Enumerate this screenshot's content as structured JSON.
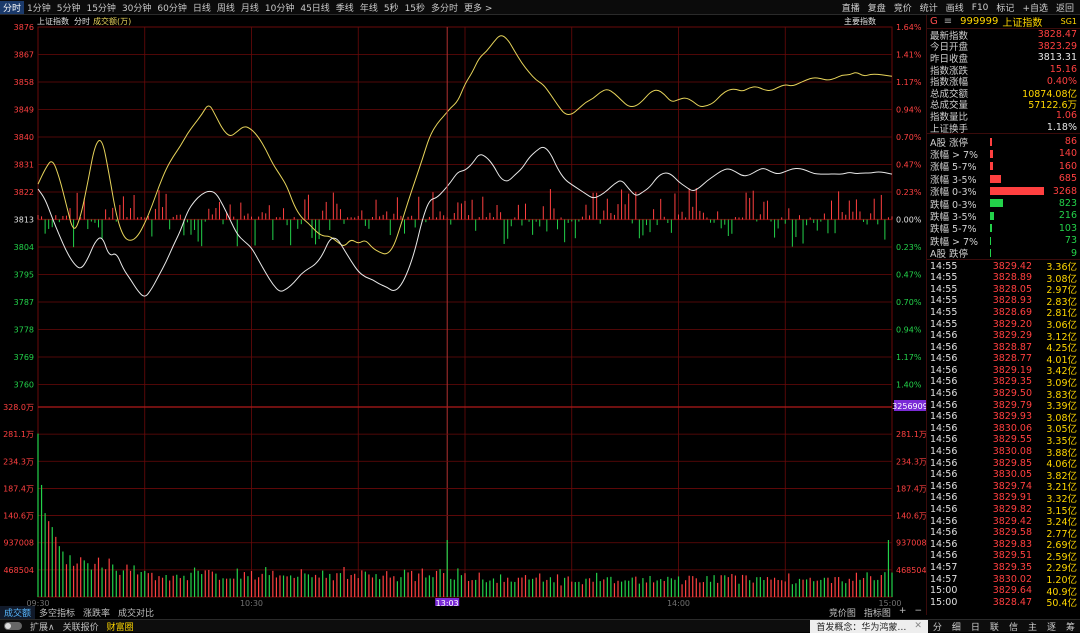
{
  "topbar": {
    "timeframes": [
      "分时",
      "1分钟",
      "5分钟",
      "15分钟",
      "30分钟",
      "60分钟",
      "日线",
      "周线",
      "月线",
      "10分钟",
      "45日线",
      "季线",
      "年线",
      "5秒",
      "15秒",
      "多分时",
      "更多 >"
    ],
    "right": [
      "直播",
      "复盘",
      "竞价",
      "统计",
      "画线",
      "F10",
      "标记",
      "+自选",
      "返回"
    ]
  },
  "chart_header": {
    "index_name": "上证指数",
    "period": "分时",
    "indicator": "成交额(万)",
    "right_label": "主要指数"
  },
  "price_axis": {
    "left": [
      "3876",
      "3867",
      "3858",
      "3849",
      "3840",
      "3831",
      "3822",
      "3813",
      "3804",
      "3795",
      "3787",
      "3778",
      "3769",
      "3760"
    ],
    "right": [
      "1.64%",
      "1.41%",
      "1.17%",
      "0.94%",
      "0.70%",
      "0.47%",
      "0.23%",
      "0.00%",
      "0.23%",
      "0.47%",
      "0.70%",
      "0.94%",
      "1.17%",
      "1.40%"
    ],
    "base_value": 3813.31
  },
  "volume_axis": {
    "left": [
      "328.0万",
      "281.1万",
      "234.3万",
      "187.4万",
      "140.6万",
      "937008",
      "468504"
    ],
    "right": [
      "281.1万",
      "234.3万",
      "187.4万",
      "140.6万",
      "937008",
      "468504"
    ],
    "highlight": "3256909"
  },
  "time_axis": {
    "labels": [
      "09:30",
      "10:30",
      "13:03",
      "14:00",
      "15:00"
    ],
    "cursor_label": "13:03"
  },
  "colors": {
    "up": "#ff4040",
    "down": "#23d24a",
    "price_line": "#e8e8e8",
    "avg_line": "#e6d35a",
    "grid": "#6a0a0a",
    "accent": "#ffd700",
    "cursor": "#7a2ad6"
  },
  "chart_data": {
    "type": "line",
    "price_series_keyframes": [
      [
        0,
        3823
      ],
      [
        4,
        3820
      ],
      [
        8,
        3814
      ],
      [
        12,
        3808
      ],
      [
        16,
        3803
      ],
      [
        20,
        3799
      ],
      [
        24,
        3797
      ],
      [
        28,
        3801
      ],
      [
        32,
        3806
      ],
      [
        36,
        3808
      ],
      [
        40,
        3801
      ],
      [
        44,
        3803
      ],
      [
        48,
        3797
      ],
      [
        52,
        3794
      ],
      [
        56,
        3790
      ],
      [
        60,
        3788
      ],
      [
        64,
        3791
      ],
      [
        68,
        3795
      ],
      [
        72,
        3800
      ],
      [
        76,
        3805
      ],
      [
        80,
        3810
      ],
      [
        84,
        3816
      ],
      [
        88,
        3820
      ],
      [
        92,
        3822
      ],
      [
        96,
        3823
      ],
      [
        100,
        3822
      ],
      [
        104,
        3818
      ],
      [
        108,
        3813
      ],
      [
        112,
        3809
      ],
      [
        116,
        3806
      ],
      [
        120,
        3804
      ],
      [
        124,
        3800
      ],
      [
        128,
        3796
      ],
      [
        132,
        3792
      ],
      [
        136,
        3790
      ],
      [
        140,
        3791
      ],
      [
        144,
        3793
      ],
      [
        148,
        3796
      ],
      [
        152,
        3798
      ],
      [
        156,
        3799
      ],
      [
        160,
        3802
      ],
      [
        164,
        3807
      ],
      [
        168,
        3808
      ],
      [
        172,
        3804
      ],
      [
        176,
        3800
      ],
      [
        180,
        3797
      ],
      [
        184,
        3795
      ],
      [
        188,
        3794
      ],
      [
        192,
        3793
      ],
      [
        196,
        3792
      ],
      [
        200,
        3790
      ],
      [
        204,
        3792
      ],
      [
        208,
        3797
      ],
      [
        212,
        3804
      ],
      [
        216,
        3814
      ],
      [
        220,
        3820
      ],
      [
        224,
        3821
      ],
      [
        228,
        3823
      ],
      [
        232,
        3826
      ],
      [
        236,
        3829
      ],
      [
        240,
        3829
      ],
      [
        244,
        3832
      ],
      [
        248,
        3835
      ],
      [
        252,
        3834
      ],
      [
        256,
        3831
      ],
      [
        260,
        3827
      ],
      [
        264,
        3826
      ],
      [
        268,
        3828
      ],
      [
        272,
        3830
      ],
      [
        276,
        3834
      ],
      [
        280,
        3836
      ],
      [
        284,
        3837
      ],
      [
        288,
        3835
      ],
      [
        292,
        3830
      ],
      [
        296,
        3827
      ],
      [
        300,
        3825
      ],
      [
        304,
        3823
      ],
      [
        308,
        3822
      ],
      [
        312,
        3820
      ],
      [
        316,
        3821
      ],
      [
        320,
        3823
      ],
      [
        324,
        3825
      ],
      [
        328,
        3826
      ],
      [
        332,
        3824
      ],
      [
        336,
        3821
      ],
      [
        340,
        3822
      ],
      [
        344,
        3824
      ],
      [
        348,
        3827
      ],
      [
        352,
        3829
      ],
      [
        356,
        3828
      ],
      [
        360,
        3826
      ],
      [
        364,
        3824
      ],
      [
        368,
        3823
      ],
      [
        372,
        3824
      ],
      [
        376,
        3826
      ],
      [
        380,
        3828
      ],
      [
        384,
        3829
      ],
      [
        388,
        3830
      ],
      [
        392,
        3829
      ],
      [
        396,
        3828
      ],
      [
        400,
        3828
      ],
      [
        404,
        3829
      ],
      [
        408,
        3830
      ],
      [
        412,
        3829
      ],
      [
        416,
        3828
      ],
      [
        420,
        3829
      ],
      [
        424,
        3830
      ],
      [
        428,
        3830
      ],
      [
        432,
        3829
      ],
      [
        436,
        3828
      ],
      [
        440,
        3828.5
      ],
      [
        444,
        3828.2
      ],
      [
        448,
        3828.4
      ],
      [
        452,
        3828.6
      ],
      [
        456,
        3828.5
      ],
      [
        460,
        3828.3
      ],
      [
        464,
        3828.4
      ],
      [
        468,
        3828.5
      ],
      [
        472,
        3828.6
      ],
      [
        476,
        3828.4
      ],
      [
        480,
        3828.47
      ]
    ],
    "avg_series_keyframes": [
      [
        0,
        3825
      ],
      [
        4,
        3830
      ],
      [
        8,
        3833
      ],
      [
        12,
        3827
      ],
      [
        16,
        3818
      ],
      [
        20,
        3809
      ],
      [
        24,
        3814
      ],
      [
        28,
        3826
      ],
      [
        32,
        3838
      ],
      [
        36,
        3840
      ],
      [
        40,
        3828
      ],
      [
        44,
        3815
      ],
      [
        48,
        3808
      ],
      [
        52,
        3806
      ],
      [
        56,
        3808
      ],
      [
        60,
        3812
      ],
      [
        64,
        3818
      ],
      [
        68,
        3824
      ],
      [
        72,
        3830
      ],
      [
        76,
        3834
      ],
      [
        80,
        3837
      ],
      [
        84,
        3841
      ],
      [
        88,
        3845
      ],
      [
        92,
        3848
      ],
      [
        96,
        3851
      ],
      [
        100,
        3847
      ],
      [
        104,
        3843
      ],
      [
        108,
        3840
      ],
      [
        112,
        3842
      ],
      [
        116,
        3844
      ],
      [
        120,
        3843
      ],
      [
        124,
        3840
      ],
      [
        128,
        3836
      ],
      [
        132,
        3832
      ],
      [
        136,
        3828
      ],
      [
        140,
        3824
      ],
      [
        144,
        3818
      ],
      [
        148,
        3814
      ],
      [
        152,
        3812
      ],
      [
        156,
        3810
      ],
      [
        160,
        3808
      ],
      [
        164,
        3808
      ],
      [
        168,
        3806
      ],
      [
        172,
        3805
      ],
      [
        176,
        3807
      ],
      [
        180,
        3806
      ],
      [
        184,
        3807
      ],
      [
        188,
        3804
      ],
      [
        192,
        3803
      ],
      [
        196,
        3802
      ],
      [
        200,
        3805
      ],
      [
        204,
        3812
      ],
      [
        208,
        3819
      ],
      [
        212,
        3826
      ],
      [
        216,
        3833
      ],
      [
        220,
        3840
      ],
      [
        224,
        3844
      ],
      [
        228,
        3847
      ],
      [
        232,
        3850
      ],
      [
        236,
        3852
      ],
      [
        240,
        3858
      ],
      [
        244,
        3861
      ],
      [
        248,
        3866
      ],
      [
        252,
        3868
      ],
      [
        256,
        3871
      ],
      [
        260,
        3874
      ],
      [
        264,
        3872
      ],
      [
        268,
        3868
      ],
      [
        272,
        3864
      ],
      [
        276,
        3861
      ],
      [
        280,
        3859
      ],
      [
        284,
        3857
      ],
      [
        288,
        3854
      ],
      [
        292,
        3851
      ],
      [
        296,
        3848
      ],
      [
        300,
        3848
      ],
      [
        304,
        3850
      ],
      [
        308,
        3852
      ],
      [
        312,
        3853
      ],
      [
        316,
        3855
      ],
      [
        320,
        3856
      ],
      [
        324,
        3854
      ],
      [
        328,
        3852
      ],
      [
        332,
        3850
      ],
      [
        336,
        3850
      ],
      [
        340,
        3852
      ],
      [
        344,
        3855
      ],
      [
        348,
        3856
      ],
      [
        352,
        3854
      ],
      [
        356,
        3852
      ],
      [
        360,
        3852
      ],
      [
        364,
        3853
      ],
      [
        368,
        3852
      ],
      [
        372,
        3850
      ],
      [
        376,
        3850
      ],
      [
        380,
        3852
      ],
      [
        384,
        3854
      ],
      [
        388,
        3856
      ],
      [
        392,
        3856
      ],
      [
        396,
        3855
      ],
      [
        400,
        3856
      ],
      [
        404,
        3857
      ],
      [
        408,
        3856
      ],
      [
        412,
        3855
      ],
      [
        416,
        3856
      ],
      [
        420,
        3857
      ],
      [
        424,
        3857
      ],
      [
        428,
        3858
      ],
      [
        432,
        3859
      ],
      [
        436,
        3860
      ],
      [
        440,
        3859
      ],
      [
        444,
        3859
      ],
      [
        448,
        3859
      ],
      [
        452,
        3860
      ],
      [
        456,
        3860
      ],
      [
        460,
        3861
      ],
      [
        464,
        3860
      ],
      [
        468,
        3861
      ],
      [
        472,
        3861
      ],
      [
        476,
        3860
      ],
      [
        480,
        3860
      ]
    ],
    "breadth_bar_seed": 1337,
    "volume_bar_seed": 42,
    "x_domain": [
      0,
      480
    ],
    "y_range": [
      3760,
      3876
    ],
    "volume_range": [
      0,
      3280000
    ]
  },
  "side": {
    "header": {
      "flag": "G",
      "eq": "≡",
      "code": "999999",
      "name": "上证指数",
      "tag": "SG1"
    },
    "stats": [
      {
        "k": "最新指数",
        "v": "3828.47",
        "c": "red"
      },
      {
        "k": "今日开盘",
        "v": "3823.29",
        "c": "red"
      },
      {
        "k": "昨日收盘",
        "v": "3813.31",
        "c": "white"
      },
      {
        "k": "指数涨跌",
        "v": "15.16",
        "c": "red"
      },
      {
        "k": "指数涨幅",
        "v": "0.40%",
        "c": "red"
      },
      {
        "k": "总成交额",
        "v": "10874.08亿",
        "c": "yellow"
      },
      {
        "k": "总成交量",
        "v": "57122.6万",
        "c": "yellow"
      },
      {
        "k": "指数量比",
        "v": "1.06",
        "c": "red"
      },
      {
        "k": "上证换手",
        "v": "1.18%",
        "c": "white"
      }
    ],
    "distribution": [
      {
        "lbl": "A股 涨停",
        "n": "86",
        "c": "red",
        "w": 2
      },
      {
        "lbl": "涨幅 > 7%",
        "n": "140",
        "c": "red",
        "w": 3
      },
      {
        "lbl": "涨幅 5-7%",
        "n": "160",
        "c": "red",
        "w": 3
      },
      {
        "lbl": "涨幅 3-5%",
        "n": "685",
        "c": "red",
        "w": 11
      },
      {
        "lbl": "涨幅 0-3%",
        "n": "3268",
        "c": "red",
        "w": 54
      },
      {
        "lbl": "跌幅 0-3%",
        "n": "823",
        "c": "green",
        "w": 13
      },
      {
        "lbl": "跌幅 3-5%",
        "n": "216",
        "c": "green",
        "w": 4
      },
      {
        "lbl": "跌幅 5-7%",
        "n": "103",
        "c": "green",
        "w": 2
      },
      {
        "lbl": "跌幅 > 7%",
        "n": "73",
        "c": "green",
        "w": 1
      },
      {
        "lbl": "A股 跌停",
        "n": "9",
        "c": "green",
        "w": 1
      }
    ],
    "ticks": [
      [
        "14:55",
        "3829.42",
        "3.36亿"
      ],
      [
        "14:55",
        "3828.89",
        "3.08亿"
      ],
      [
        "14:55",
        "3828.05",
        "2.97亿"
      ],
      [
        "14:55",
        "3828.93",
        "2.83亿"
      ],
      [
        "14:55",
        "3828.69",
        "2.81亿"
      ],
      [
        "14:55",
        "3829.20",
        "3.06亿"
      ],
      [
        "14:56",
        "3829.29",
        "3.12亿"
      ],
      [
        "14:56",
        "3828.87",
        "4.25亿"
      ],
      [
        "14:56",
        "3828.77",
        "4.01亿"
      ],
      [
        "14:56",
        "3829.19",
        "3.42亿"
      ],
      [
        "14:56",
        "3829.35",
        "3.09亿"
      ],
      [
        "14:56",
        "3829.50",
        "3.83亿"
      ],
      [
        "14:56",
        "3829.79",
        "3.39亿"
      ],
      [
        "14:56",
        "3829.93",
        "3.08亿"
      ],
      [
        "14:56",
        "3830.06",
        "3.05亿"
      ],
      [
        "14:56",
        "3829.55",
        "3.35亿"
      ],
      [
        "14:56",
        "3830.08",
        "3.88亿"
      ],
      [
        "14:56",
        "3829.85",
        "4.06亿"
      ],
      [
        "14:56",
        "3830.05",
        "3.82亿"
      ],
      [
        "14:56",
        "3829.74",
        "3.21亿"
      ],
      [
        "14:56",
        "3829.91",
        "3.32亿"
      ],
      [
        "14:56",
        "3829.82",
        "3.15亿"
      ],
      [
        "14:56",
        "3829.42",
        "3.24亿"
      ],
      [
        "14:56",
        "3829.58",
        "2.77亿"
      ],
      [
        "14:56",
        "3829.83",
        "2.69亿"
      ],
      [
        "14:56",
        "3829.51",
        "2.59亿"
      ],
      [
        "14:57",
        "3829.35",
        "2.29亿"
      ],
      [
        "14:57",
        "3830.02",
        "1.20亿"
      ],
      [
        "15:00",
        "3829.64",
        "40.9亿"
      ],
      [
        "15:00",
        "3828.47",
        "50.4亿"
      ]
    ]
  },
  "bottombar": {
    "items": [
      "成交额",
      "多空指标",
      "涨跌率",
      "成交对比"
    ],
    "right": [
      "竞价图",
      "指标图",
      "+",
      "−"
    ]
  },
  "statusbar": {
    "items": [
      "扩展∧",
      "关联报价",
      "财富圈"
    ],
    "ad_text": "首发概念：华为鸿蒙…",
    "nav": [
      "分",
      "细",
      "日",
      "联",
      "信",
      "主",
      "逐",
      "筹"
    ]
  }
}
